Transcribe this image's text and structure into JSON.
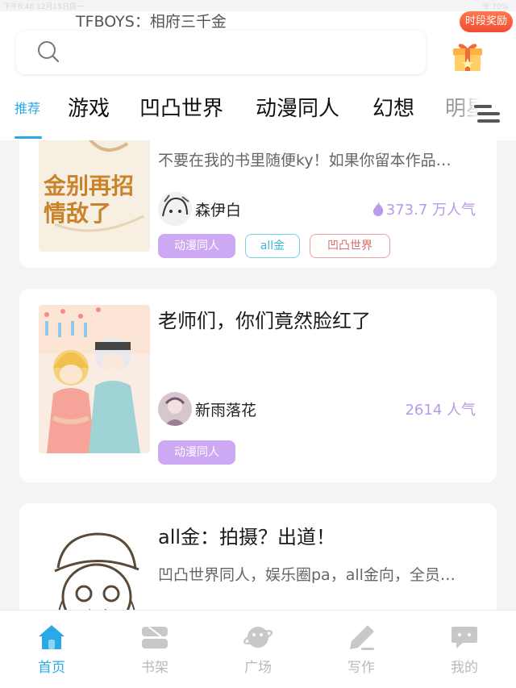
{
  "status_bar": {
    "left": "下午8:48  12月15日周一",
    "right": "令 70%"
  },
  "search": {
    "placeholder_text": "TFBOYS：相府三千金"
  },
  "reward": {
    "badge": "时段奖励"
  },
  "tabs": [
    {
      "label": "推荐",
      "active": true
    },
    {
      "label": "游戏"
    },
    {
      "label": "凹凸世界"
    },
    {
      "label": "动漫同人"
    },
    {
      "label": "幻想"
    },
    {
      "label": "明星"
    }
  ],
  "books": [
    {
      "title": "",
      "description": "不要在我的书里随便ky！如果你留本作品…",
      "cover_text": "金别再招情敌了",
      "author": "森伊白",
      "popularity": "373.7 万人气",
      "hot": true,
      "tags": [
        {
          "label": "动漫同人",
          "style": "purple"
        },
        {
          "label": "all金",
          "style": "cyan"
        },
        {
          "label": "凹凸世界",
          "style": "red"
        }
      ]
    },
    {
      "title": "老师们，你们竟然脸红了",
      "description": "",
      "author": "新雨落花",
      "popularity": "2614 人气",
      "hot": false,
      "tags": [
        {
          "label": "动漫同人",
          "style": "purple"
        }
      ]
    },
    {
      "title": "all金：拍摄？出道！",
      "description": "凹凸世界同人，娱乐圈pa，all金向，全员…",
      "author": "",
      "popularity": "",
      "tags": []
    }
  ],
  "tabbar": [
    {
      "label": "首页",
      "icon": "home-icon",
      "active": true
    },
    {
      "label": "书架",
      "icon": "bookshelf-icon"
    },
    {
      "label": "广场",
      "icon": "planet-icon"
    },
    {
      "label": "写作",
      "icon": "pen-icon"
    },
    {
      "label": "我的",
      "icon": "chat-bubble-icon"
    }
  ],
  "colors": {
    "accent": "#2aa8e8",
    "popularity": "#b99ae6",
    "tag_purple": "#cda8f3",
    "reward": "#f04b35"
  }
}
